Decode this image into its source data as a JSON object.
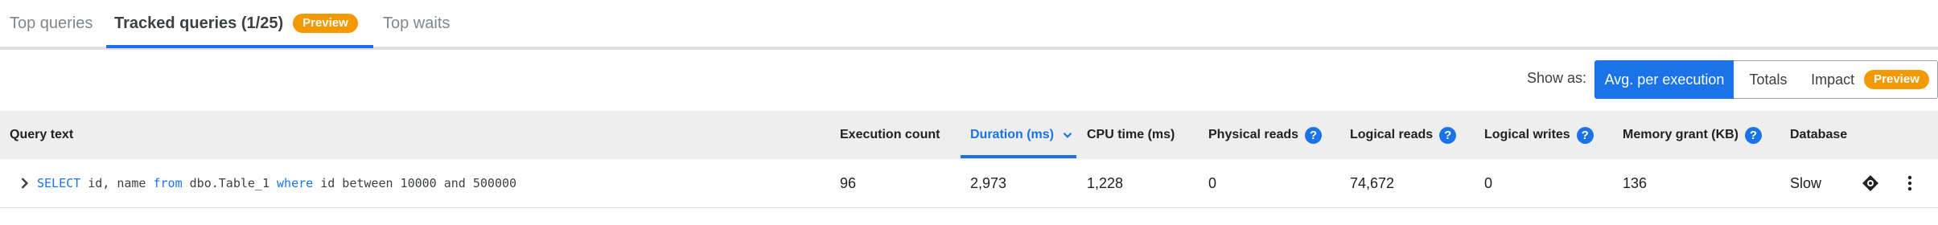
{
  "tabs": [
    {
      "label": "Top queries"
    },
    {
      "label": "Tracked queries (1/25)",
      "badge": "Preview"
    },
    {
      "label": "Top waits"
    }
  ],
  "show_as": {
    "label": "Show as:",
    "options": [
      {
        "label": "Avg. per execution",
        "selected": true
      },
      {
        "label": "Totals"
      },
      {
        "label": "Impact",
        "badge": "Preview"
      }
    ]
  },
  "table": {
    "columns": [
      {
        "label": "Query text"
      },
      {
        "label": "Execution count"
      },
      {
        "label": "Duration (ms)",
        "sorted": "desc"
      },
      {
        "label": "CPU time (ms)"
      },
      {
        "label": "Physical reads",
        "help": "?"
      },
      {
        "label": "Logical reads",
        "help": "?"
      },
      {
        "label": "Logical writes",
        "help": "?"
      },
      {
        "label": "Memory grant (KB)",
        "help": "?"
      },
      {
        "label": "Database"
      }
    ],
    "rows": [
      {
        "query": [
          {
            "t": "SELECT",
            "kw": true
          },
          {
            "t": " id, name "
          },
          {
            "t": "from",
            "kw": true
          },
          {
            "t": " dbo.Table_1 "
          },
          {
            "t": "where",
            "kw": true
          },
          {
            "t": " id between 10000 and 500000"
          }
        ],
        "execution_count": "96",
        "duration": "2,973",
        "cpu_time": "1,228",
        "physical_reads": "0",
        "logical_reads": "74,672",
        "logical_writes": "0",
        "memory_grant": "136",
        "database": "Slow"
      }
    ]
  },
  "icons": {
    "expand": "chevron-right-icon",
    "sort": "chevron-down-icon",
    "track": "target-icon",
    "more": "more-vert-icon"
  },
  "colors": {
    "accent": "#1a73e8",
    "preview_badge": "#f29900",
    "header_bg": "#eeeeee"
  }
}
